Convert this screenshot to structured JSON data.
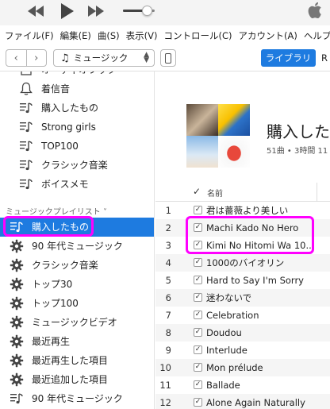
{
  "player": {
    "volume": 0.75,
    "icons": [
      "rewind-icon",
      "play-icon",
      "fast-forward-icon",
      "apple-logo-icon"
    ]
  },
  "menu": [
    "ファイル(F)",
    "編集(E)",
    "曲(S)",
    "表示(V)",
    "コントロール(C)",
    "アカウント(A)",
    "ヘルプ(H)"
  ],
  "toolbar": {
    "back": "‹",
    "forward": "›",
    "media_kind": "ミュージック",
    "library_label": "ライブラリ",
    "next_tab_partial": "R"
  },
  "sidebar": {
    "top_items": [
      {
        "label": "オーディオブック",
        "icon": "audiobook-icon"
      },
      {
        "label": "着信音",
        "icon": "bell-icon"
      },
      {
        "label": "購入したもの",
        "icon": "playlist-icon"
      },
      {
        "label": "Strong girls",
        "icon": "playlist-icon"
      },
      {
        "label": "TOP100",
        "icon": "playlist-icon"
      },
      {
        "label": "クラシック音楽",
        "icon": "playlist-icon"
      },
      {
        "label": "ボイスメモ",
        "icon": "playlist-icon"
      }
    ],
    "section_title": "ミュージックプレイリスト ˅",
    "playlists": [
      {
        "label": "購入したもの",
        "icon": "playlist-icon",
        "selected": true
      },
      {
        "label": "90 年代ミュージック",
        "icon": "gear-icon"
      },
      {
        "label": "クラシック音楽",
        "icon": "gear-icon"
      },
      {
        "label": "トップ30",
        "icon": "gear-icon"
      },
      {
        "label": "トップ100",
        "icon": "gear-icon"
      },
      {
        "label": "ミュージックビデオ",
        "icon": "gear-icon"
      },
      {
        "label": "最近再生",
        "icon": "gear-icon"
      },
      {
        "label": "最近再生した項目",
        "icon": "gear-icon"
      },
      {
        "label": "最近追加した項目",
        "icon": "gear-icon"
      },
      {
        "label": "90 年代ミュージック",
        "icon": "playlist-icon"
      }
    ]
  },
  "main": {
    "playlist_title": "購入した",
    "meta": "51曲 • 3時間 11",
    "columns": {
      "check": "✓",
      "name": "名前"
    },
    "tracks": [
      {
        "num": "1",
        "name": "君は薔薇より美しい"
      },
      {
        "num": "2",
        "name": "Machi Kado No Hero"
      },
      {
        "num": "3",
        "name": "Kimi No Hitomi Wa 10..."
      },
      {
        "num": "4",
        "name": "1000のバイオリン"
      },
      {
        "num": "5",
        "name": "Hard to Say I'm Sorry"
      },
      {
        "num": "6",
        "name": "迷わないで"
      },
      {
        "num": "7",
        "name": "Celebration"
      },
      {
        "num": "8",
        "name": "Doudou"
      },
      {
        "num": "9",
        "name": "Interlude"
      },
      {
        "num": "10",
        "name": "Mon prélude"
      },
      {
        "num": "11",
        "name": "Ballade"
      },
      {
        "num": "12",
        "name": "Alone Again Naturally"
      }
    ]
  },
  "colors": {
    "accent": "#1e7be0",
    "annotation": "#ff00ff"
  }
}
